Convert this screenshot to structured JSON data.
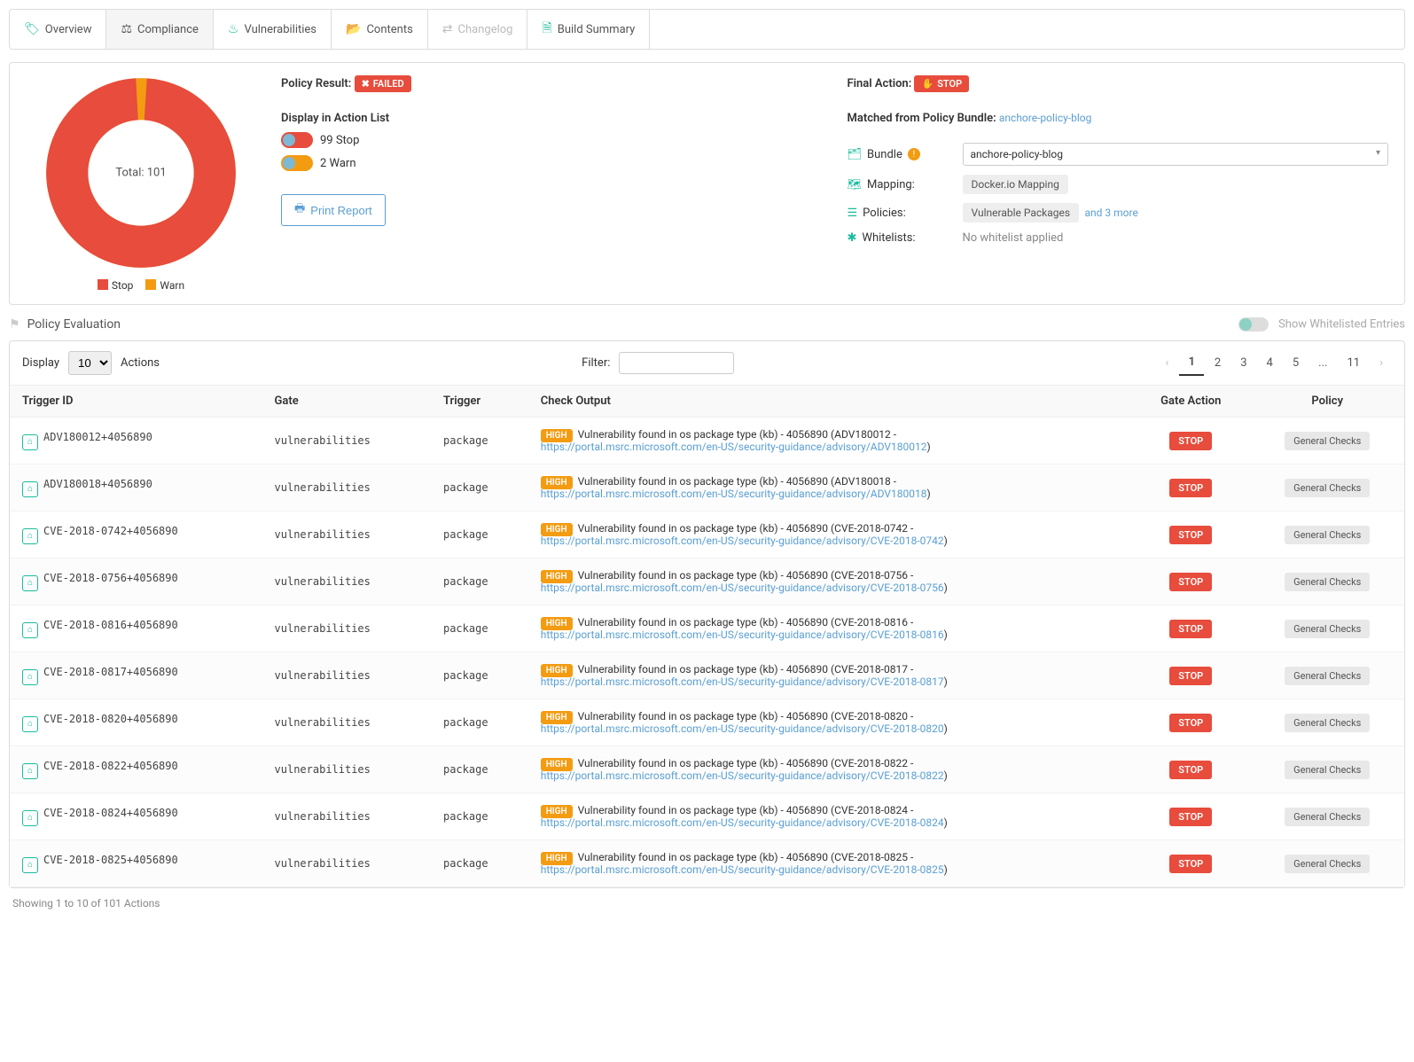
{
  "tabs": [
    {
      "label": "Overview",
      "icon": "🏷"
    },
    {
      "label": "Compliance",
      "icon": "⚖"
    },
    {
      "label": "Vulnerabilities",
      "icon": "🔥"
    },
    {
      "label": "Contents",
      "icon": "📂"
    },
    {
      "label": "Changelog",
      "icon": "⇄"
    },
    {
      "label": "Build Summary",
      "icon": "📄"
    }
  ],
  "chart_data": {
    "type": "pie",
    "title": "",
    "center_label": "Total: 101",
    "percent_label": "98.0%",
    "series": [
      {
        "name": "Stop",
        "value": 99,
        "color": "#e74c3c"
      },
      {
        "name": "Warn",
        "value": 2,
        "color": "#f39c12"
      }
    ]
  },
  "policy_result": {
    "label": "Policy Result:",
    "badge": "FAILED"
  },
  "display_in": {
    "label": "Display in Action List",
    "items": [
      {
        "text": "99 Stop",
        "color": "red"
      },
      {
        "text": "2 Warn",
        "color": "orange"
      }
    ]
  },
  "print_label": "Print Report",
  "final_action": {
    "label": "Final Action:",
    "badge": "STOP"
  },
  "matched": {
    "label": "Matched from Policy Bundle:",
    "value": "anchore-policy-blog"
  },
  "bundle_row": {
    "label": "Bundle",
    "value": "anchore-policy-blog"
  },
  "mapping_row": {
    "label": "Mapping:",
    "value": "Docker.io Mapping"
  },
  "policies_row": {
    "label": "Policies:",
    "value": "Vulnerable Packages",
    "extra": "and 3 more"
  },
  "whitelists_row": {
    "label": "Whitelists:",
    "value": "No whitelist applied"
  },
  "section_title": "Policy Evaluation",
  "show_wl": "Show Whitelisted Entries",
  "controls": {
    "display": "Display",
    "display_val": "10",
    "actions": "Actions",
    "filter": "Filter:"
  },
  "pager": [
    "1",
    "2",
    "3",
    "4",
    "5",
    "...",
    "11"
  ],
  "columns": [
    "Trigger ID",
    "Gate",
    "Trigger",
    "Check Output",
    "Gate Action",
    "Policy"
  ],
  "severity": "HIGH",
  "gate_action": "STOP",
  "policy_chip": "General Checks",
  "rows": [
    {
      "id": "ADV180012+4056890",
      "gate": "vulnerabilities",
      "trigger": "package",
      "out": "Vulnerability found in os package type (kb) - 4056890 (ADV180012 - ",
      "url": "https://portal.msrc.microsoft.com/en-US/security-guidance/advisory/ADV180012"
    },
    {
      "id": "ADV180018+4056890",
      "gate": "vulnerabilities",
      "trigger": "package",
      "out": "Vulnerability found in os package type (kb) - 4056890 (ADV180018 - ",
      "url": "https://portal.msrc.microsoft.com/en-US/security-guidance/advisory/ADV180018"
    },
    {
      "id": "CVE-2018-0742+4056890",
      "gate": "vulnerabilities",
      "trigger": "package",
      "out": "Vulnerability found in os package type (kb) - 4056890 (CVE-2018-0742 - ",
      "url": "https://portal.msrc.microsoft.com/en-US/security-guidance/advisory/CVE-2018-0742"
    },
    {
      "id": "CVE-2018-0756+4056890",
      "gate": "vulnerabilities",
      "trigger": "package",
      "out": "Vulnerability found in os package type (kb) - 4056890 (CVE-2018-0756 - ",
      "url": "https://portal.msrc.microsoft.com/en-US/security-guidance/advisory/CVE-2018-0756"
    },
    {
      "id": "CVE-2018-0816+4056890",
      "gate": "vulnerabilities",
      "trigger": "package",
      "out": "Vulnerability found in os package type (kb) - 4056890 (CVE-2018-0816 - ",
      "url": "https://portal.msrc.microsoft.com/en-US/security-guidance/advisory/CVE-2018-0816"
    },
    {
      "id": "CVE-2018-0817+4056890",
      "gate": "vulnerabilities",
      "trigger": "package",
      "out": "Vulnerability found in os package type (kb) - 4056890 (CVE-2018-0817 - ",
      "url": "https://portal.msrc.microsoft.com/en-US/security-guidance/advisory/CVE-2018-0817"
    },
    {
      "id": "CVE-2018-0820+4056890",
      "gate": "vulnerabilities",
      "trigger": "package",
      "out": "Vulnerability found in os package type (kb) - 4056890 (CVE-2018-0820 - ",
      "url": "https://portal.msrc.microsoft.com/en-US/security-guidance/advisory/CVE-2018-0820"
    },
    {
      "id": "CVE-2018-0822+4056890",
      "gate": "vulnerabilities",
      "trigger": "package",
      "out": "Vulnerability found in os package type (kb) - 4056890 (CVE-2018-0822 - ",
      "url": "https://portal.msrc.microsoft.com/en-US/security-guidance/advisory/CVE-2018-0822"
    },
    {
      "id": "CVE-2018-0824+4056890",
      "gate": "vulnerabilities",
      "trigger": "package",
      "out": "Vulnerability found in os package type (kb) - 4056890 (CVE-2018-0824 - ",
      "url": "https://portal.msrc.microsoft.com/en-US/security-guidance/advisory/CVE-2018-0824"
    },
    {
      "id": "CVE-2018-0825+4056890",
      "gate": "vulnerabilities",
      "trigger": "package",
      "out": "Vulnerability found in os package type (kb) - 4056890 (CVE-2018-0825 - ",
      "url": "https://portal.msrc.microsoft.com/en-US/security-guidance/advisory/CVE-2018-0825"
    }
  ],
  "footer": "Showing 1 to 10 of 101 Actions"
}
